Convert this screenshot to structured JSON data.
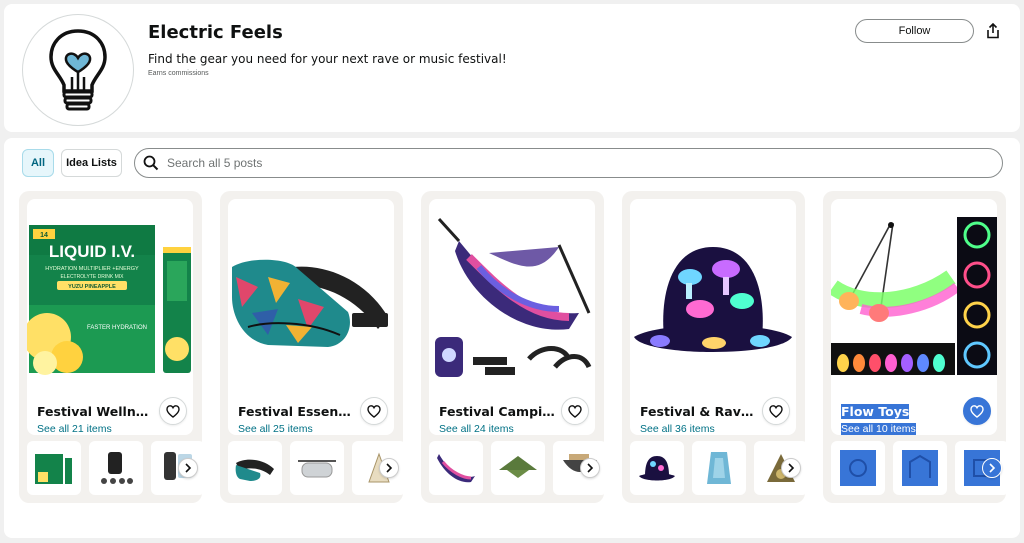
{
  "store": {
    "title": "Electric Feels",
    "description": "Find the gear you need for your next rave or music festival!",
    "earns": "Earns commissions",
    "follow_label": "Follow",
    "icons": {
      "logo": "lightbulb-heart-icon",
      "share": "share-icon"
    }
  },
  "tabs": [
    {
      "label": "All",
      "active": true
    },
    {
      "label": "Idea Lists",
      "active": false
    }
  ],
  "search": {
    "placeholder": "Search all 5 posts",
    "icon": "search-icon"
  },
  "collections": [
    {
      "name": "Festival Wellness",
      "see_all": "See all 21 items"
    },
    {
      "name": "Festival Essentials",
      "see_all": "See all 25 items"
    },
    {
      "name": "Festival Camping",
      "see_all": "See all 24 items"
    },
    {
      "name": "Festival & Rave...",
      "see_all": "See all 36 items"
    },
    {
      "name": "Flow Toys",
      "see_all": "See all 10 items",
      "selected": true
    }
  ],
  "product_text": {
    "liquid_brand": "LIQUID I.V.",
    "liquid_badge": "14",
    "liquid_line1": "HYDRATION MULTIPLIER +ENERGY",
    "liquid_line2": "ELECTROLYTE DRINK MIX",
    "liquid_flavor": "YUZU PINEAPPLE",
    "liquid_claim": "FASTER HYDRATION"
  },
  "colors": {
    "link": "#007185",
    "accent_tab": "#e6f6fb",
    "card_bg": "#f3f1ee",
    "selection": "#3875d7"
  }
}
